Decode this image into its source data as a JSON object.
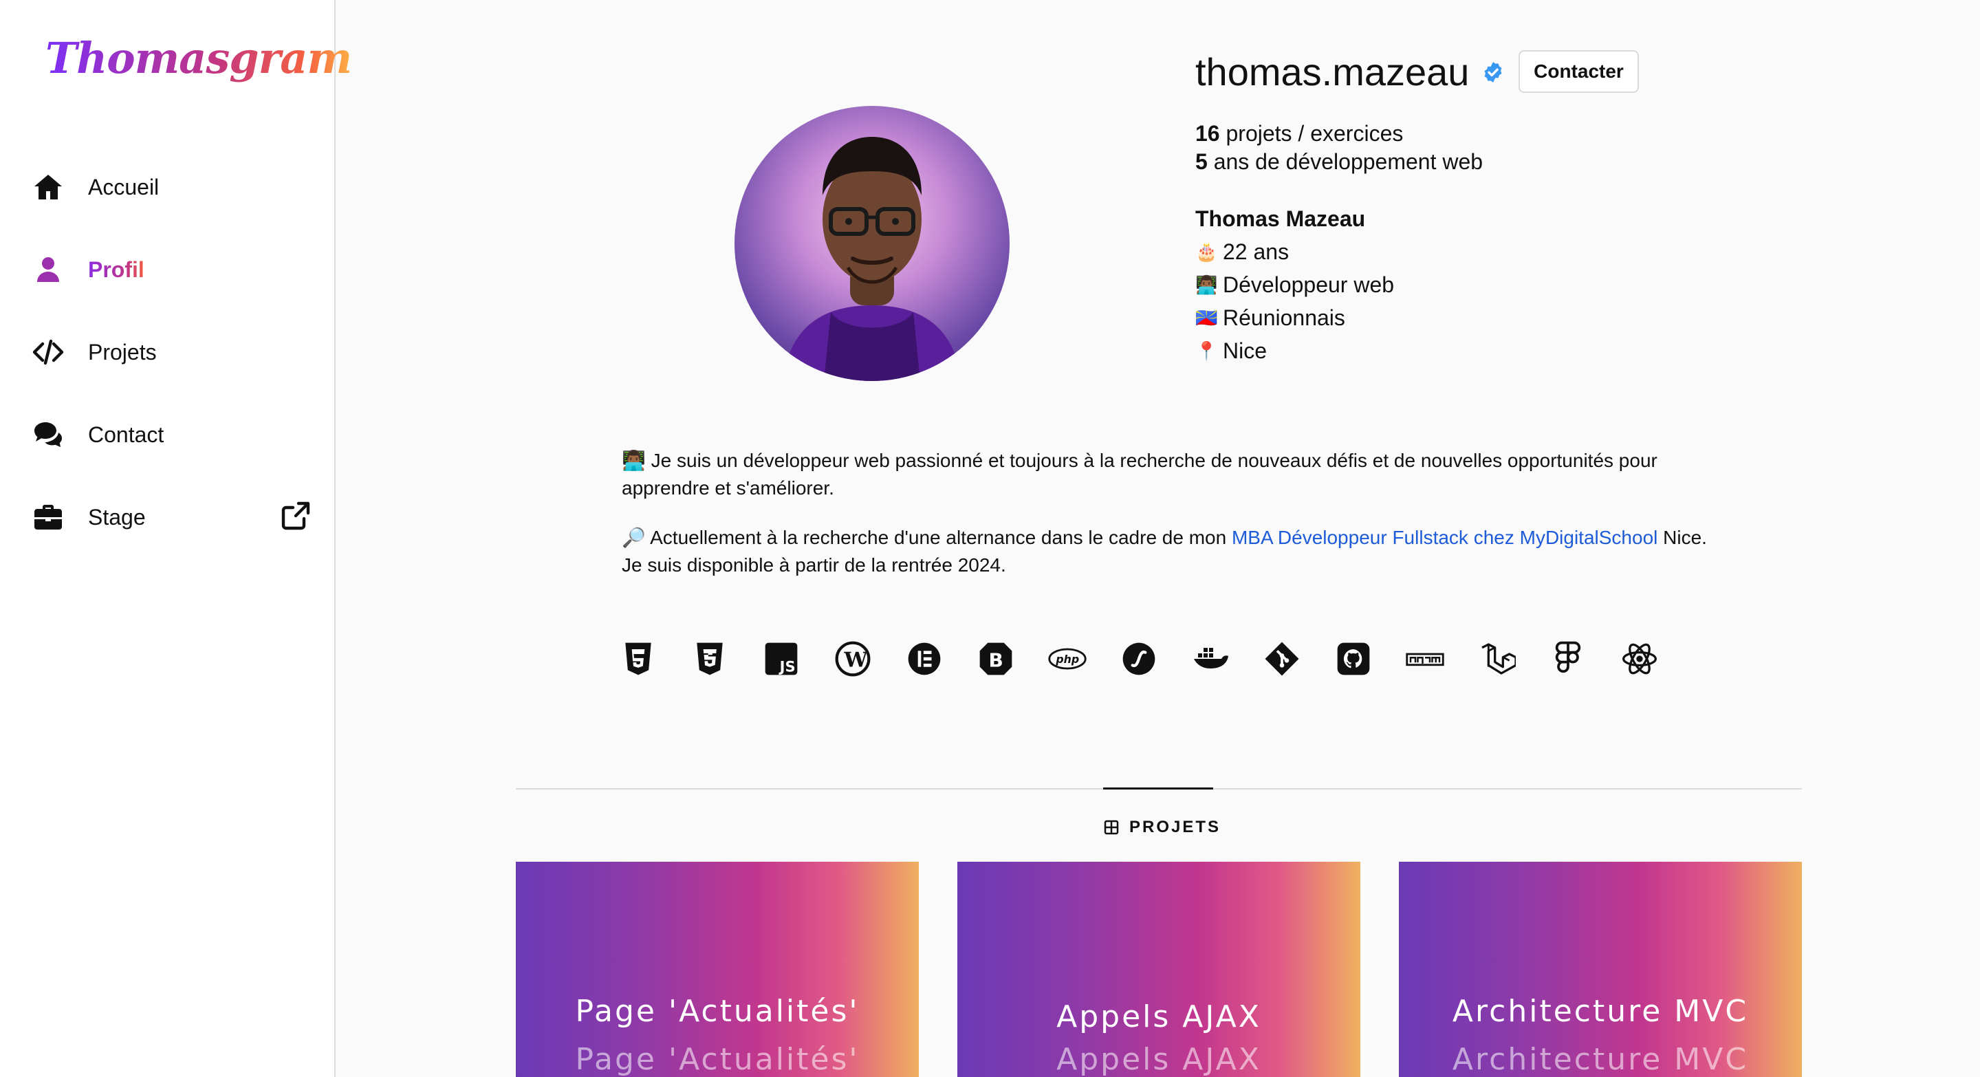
{
  "app": {
    "logo": "Thomasgram"
  },
  "sidebar": {
    "items": [
      {
        "label": "Accueil",
        "icon": "home-icon"
      },
      {
        "label": "Profil",
        "icon": "user-icon",
        "active": true
      },
      {
        "label": "Projets",
        "icon": "code-icon"
      },
      {
        "label": "Contact",
        "icon": "comments-icon"
      },
      {
        "label": "Stage",
        "icon": "briefcase-icon",
        "external": true
      }
    ]
  },
  "profile": {
    "username": "thomas.mazeau",
    "contact_label": "Contacter",
    "stats": [
      {
        "value": "16",
        "label": " projets / exercices"
      },
      {
        "value": "5",
        "label": " ans de développement web"
      }
    ],
    "name": "Thomas Mazeau",
    "details": [
      {
        "emoji": "🎂",
        "text": "22 ans"
      },
      {
        "emoji": "👨🏾‍💻",
        "text": "Développeur web"
      },
      {
        "emoji": "🇷🇪",
        "text": "Réunionnais"
      },
      {
        "emoji": "📍",
        "text": "Nice"
      }
    ],
    "bio_1_emoji": "👨🏾‍💻",
    "bio_1": " Je suis un développeur web passionné et toujours à la recherche de nouveaux défis et de nouvelles opportunités pour apprendre et s'améliorer.",
    "bio_2_emoji": "🔎",
    "bio_2_before": " Actuellement à la recherche d'une alternance dans le cadre de mon ",
    "bio_2_link": "MBA Développeur Fullstack chez MyDigitalSchool",
    "bio_2_after": " Nice. Je suis disponible à partir de la rentrée 2024."
  },
  "skills": [
    "html5-icon",
    "css3-icon",
    "js-icon",
    "wordpress-icon",
    "elementor-icon",
    "bootstrap-icon",
    "php-icon",
    "symfony-icon",
    "docker-icon",
    "git-icon",
    "github-icon",
    "npm-icon",
    "laravel-icon",
    "figma-icon",
    "react-icon"
  ],
  "tabs": {
    "projets_label": "PROJETS"
  },
  "projects": [
    {
      "title": "Page 'Actualités'"
    },
    {
      "title": "Appels AJAX"
    },
    {
      "title": "Architecture MVC"
    }
  ],
  "colors": {
    "accent": "#c13584",
    "link": "#1d5bd8",
    "verified": "#3897f0"
  }
}
